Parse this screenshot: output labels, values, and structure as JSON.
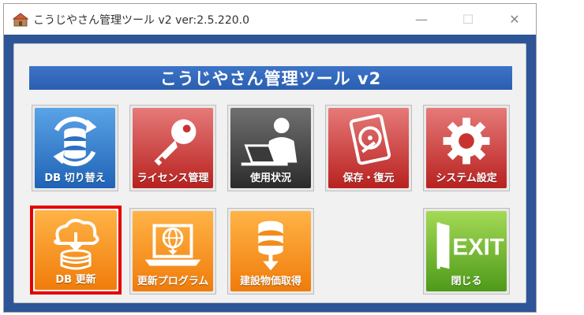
{
  "window": {
    "title": "こうじやさん管理ツール v2   ver:2.5.220.0",
    "controls": {
      "minimize": "—",
      "maximize": "☐",
      "close": "✕"
    }
  },
  "banner": {
    "text": "こうじやさん管理ツール v2"
  },
  "tiles": [
    {
      "label": "DB 切り替え",
      "icon": "database-switch-icon",
      "color": "#2a6fc4"
    },
    {
      "label": "ライセンス管理",
      "icon": "key-icon",
      "color": "#c83331"
    },
    {
      "label": "使用状況",
      "icon": "user-laptop-icon",
      "color": "#3a3a3a"
    },
    {
      "label": "保存・復元",
      "icon": "disk-icon",
      "color": "#c83331"
    },
    {
      "label": "システム設定",
      "icon": "gear-icon",
      "color": "#c83331"
    },
    {
      "label": "DB 更新",
      "icon": "cloud-database-icon",
      "color": "#f28c1c",
      "selected": true
    },
    {
      "label": "更新プログラム",
      "icon": "laptop-globe-icon",
      "color": "#f28c1c"
    },
    {
      "label": "建設物価取得",
      "icon": "database-download-icon",
      "color": "#f28c1c"
    },
    {
      "label": "閉じる",
      "icon": "exit-door-icon",
      "color": "#6cb42b",
      "badge": "EXIT"
    }
  ]
}
